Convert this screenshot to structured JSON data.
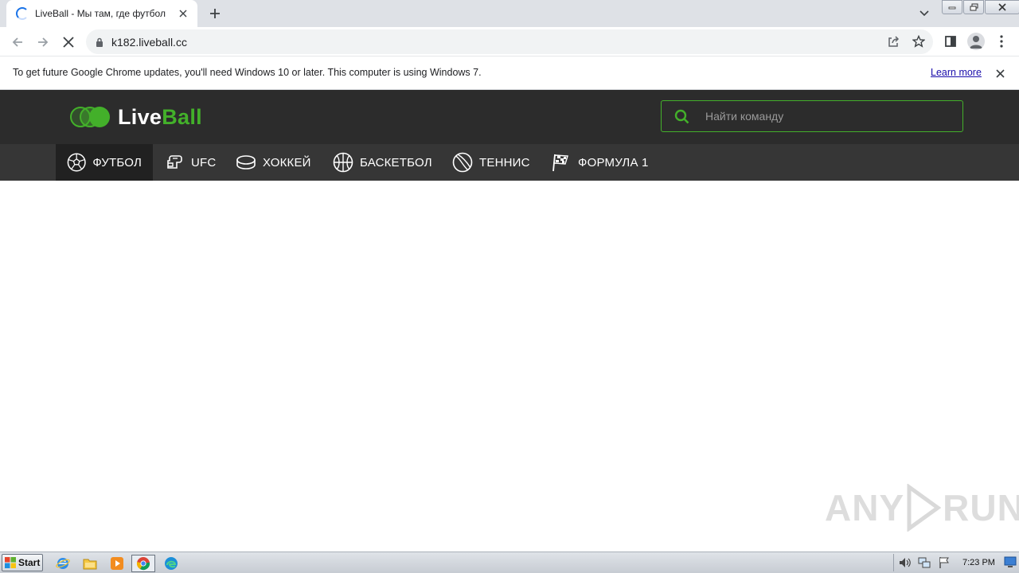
{
  "browser": {
    "tab": {
      "title": "LiveBall - Мы там, где футбол"
    },
    "address": {
      "url": "k182.liveball.cc"
    }
  },
  "infobar": {
    "message": "To get future Google Chrome updates, you'll need Windows 10 or later. This computer is using Windows 7.",
    "link": "Learn more"
  },
  "site": {
    "logo": {
      "part1": "Live",
      "part2": "Ball"
    },
    "search": {
      "placeholder": "Найти команду"
    },
    "colors": {
      "accent": "#43b02a",
      "header_bg": "#2c2c2c",
      "nav_bg": "#363636",
      "nav_active_bg": "#212121"
    },
    "nav": [
      {
        "label": "ФУТБОЛ",
        "icon": "soccer-ball-icon",
        "active": true
      },
      {
        "label": "UFC",
        "icon": "boxing-glove-icon"
      },
      {
        "label": "ХОККЕЙ",
        "icon": "hockey-puck-icon"
      },
      {
        "label": "БАСКЕТБОЛ",
        "icon": "basketball-icon"
      },
      {
        "label": "ТЕННИС",
        "icon": "tennis-ball-icon"
      },
      {
        "label": "ФОРМУЛА 1",
        "icon": "checkered-flag-icon"
      }
    ]
  },
  "watermark": {
    "left": "ANY",
    "right": "RUN"
  },
  "taskbar": {
    "start": "Start",
    "clock": "7:23 PM"
  }
}
